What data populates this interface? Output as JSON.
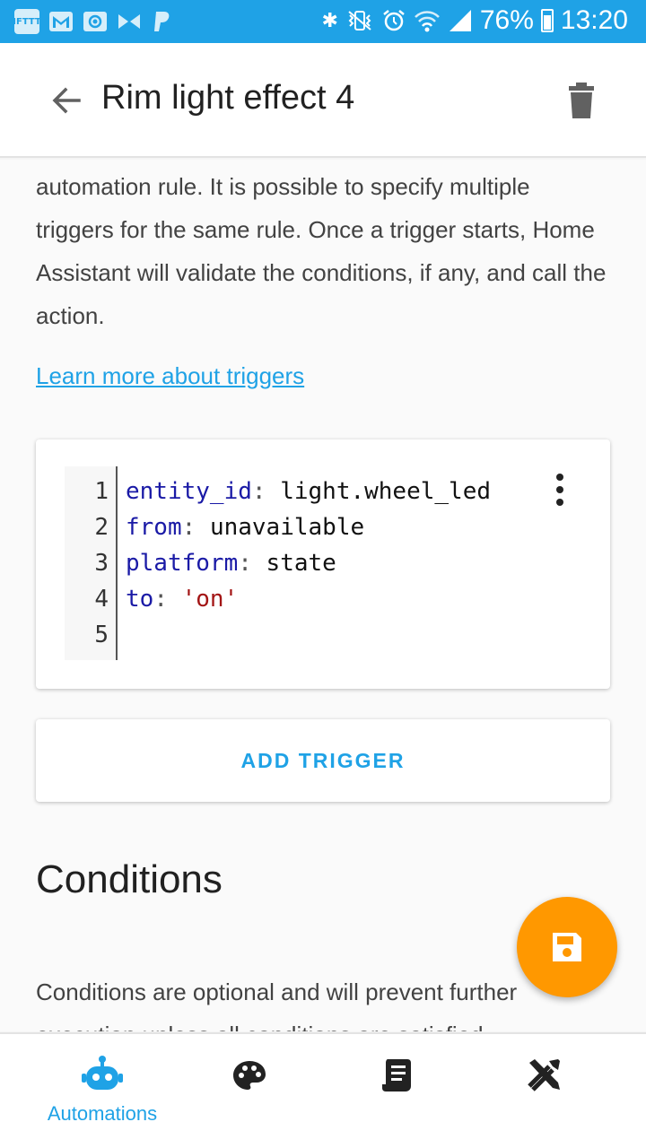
{
  "status_bar": {
    "left_icons": [
      "ifttt-icon",
      "gmail-icon",
      "email-icon",
      "messenger-icon",
      "paypal-icon"
    ],
    "ifttt_label": "IFTTT",
    "battery": "76%",
    "time": "13:20"
  },
  "app_bar": {
    "title": "Rim light effect 4"
  },
  "triggers": {
    "description": "automation rule. It is possible to specify multiple triggers for the same rule. Once a trigger starts, Home Assistant will validate the conditions, if any, and call the action.",
    "learn_more": "Learn more about triggers",
    "yaml_lines": [
      {
        "num": "1",
        "key": "entity_id",
        "value": "light.wheel_led",
        "value_type": "plain"
      },
      {
        "num": "2",
        "key": "from",
        "value": "unavailable",
        "value_type": "plain"
      },
      {
        "num": "3",
        "key": "platform",
        "value": "state",
        "value_type": "plain"
      },
      {
        "num": "4",
        "key": "to",
        "value": "'on'",
        "value_type": "string"
      },
      {
        "num": "5",
        "key": "",
        "value": "",
        "value_type": "plain"
      }
    ],
    "add_trigger": "ADD TRIGGER"
  },
  "conditions": {
    "title": "Conditions",
    "description": "Conditions are optional and will prevent further execution unless all conditions are satisfied."
  },
  "bottom_nav": {
    "items": [
      {
        "icon": "robot-icon",
        "label": "Automations",
        "active": true
      },
      {
        "icon": "palette-icon",
        "label": "",
        "active": false
      },
      {
        "icon": "script-icon",
        "label": "",
        "active": false
      },
      {
        "icon": "tools-icon",
        "label": "",
        "active": false
      }
    ]
  },
  "colors": {
    "accent": "#1fa2e6",
    "fab": "#ff9800"
  }
}
